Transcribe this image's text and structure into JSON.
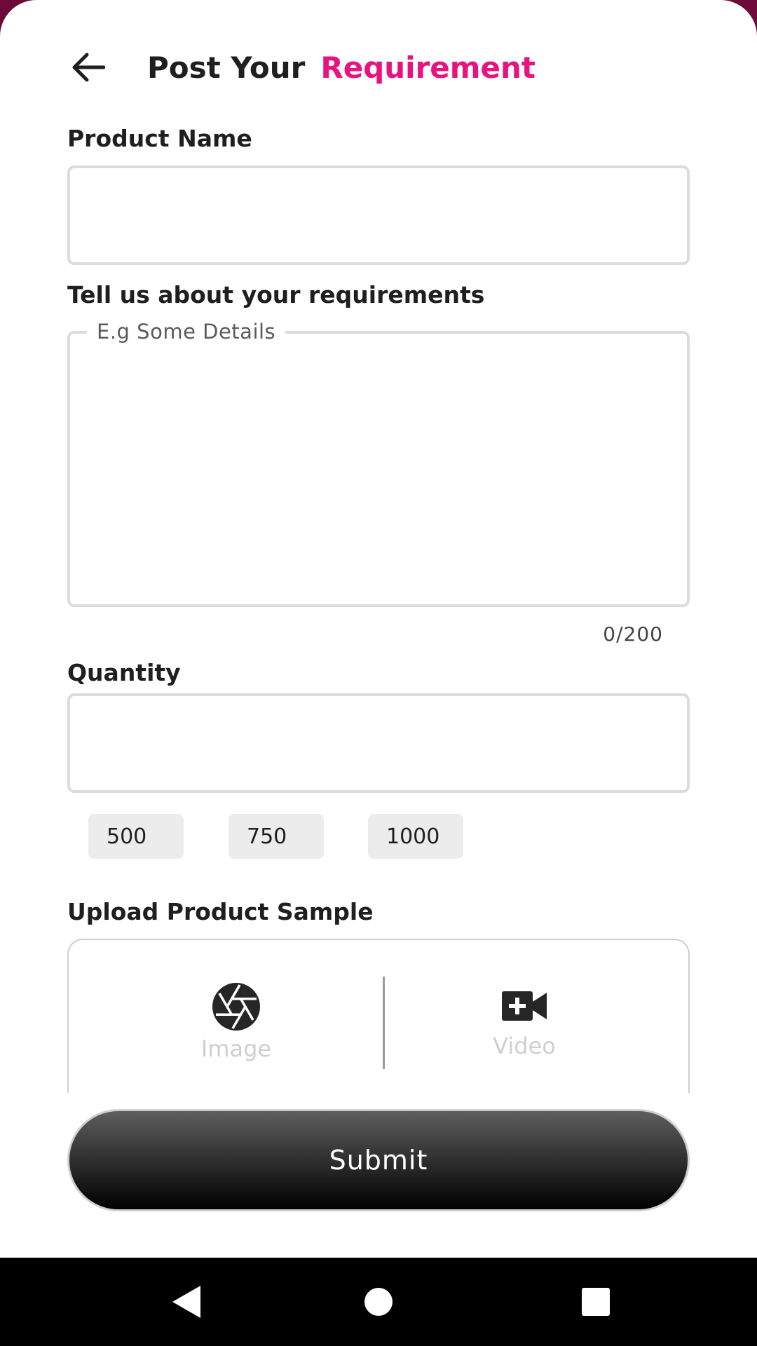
{
  "header": {
    "title_part1": "Post Your",
    "title_part2": "Requirement"
  },
  "fields": {
    "product_name_label": "Product Name",
    "product_name_value": "",
    "requirements_label": "Tell us about your requirements",
    "requirements_placeholder": "E.g Some Details",
    "requirements_value": "",
    "requirements_counter": "0/200",
    "quantity_label": "Quantity",
    "quantity_value": ""
  },
  "quantity_chips": [
    "500",
    "750",
    "1000"
  ],
  "upload": {
    "label": "Upload Product Sample",
    "image_label": "Image",
    "video_label": "Video"
  },
  "submit_label": "Submit",
  "colors": {
    "accent": "#e8137f",
    "background_top": "#6d0a3a"
  },
  "icons": {
    "back": "arrow-left-icon",
    "image": "camera-aperture-icon",
    "video": "video-add-icon",
    "nav_back": "triangle-back-icon",
    "nav_home": "circle-home-icon",
    "nav_recents": "square-recents-icon"
  }
}
